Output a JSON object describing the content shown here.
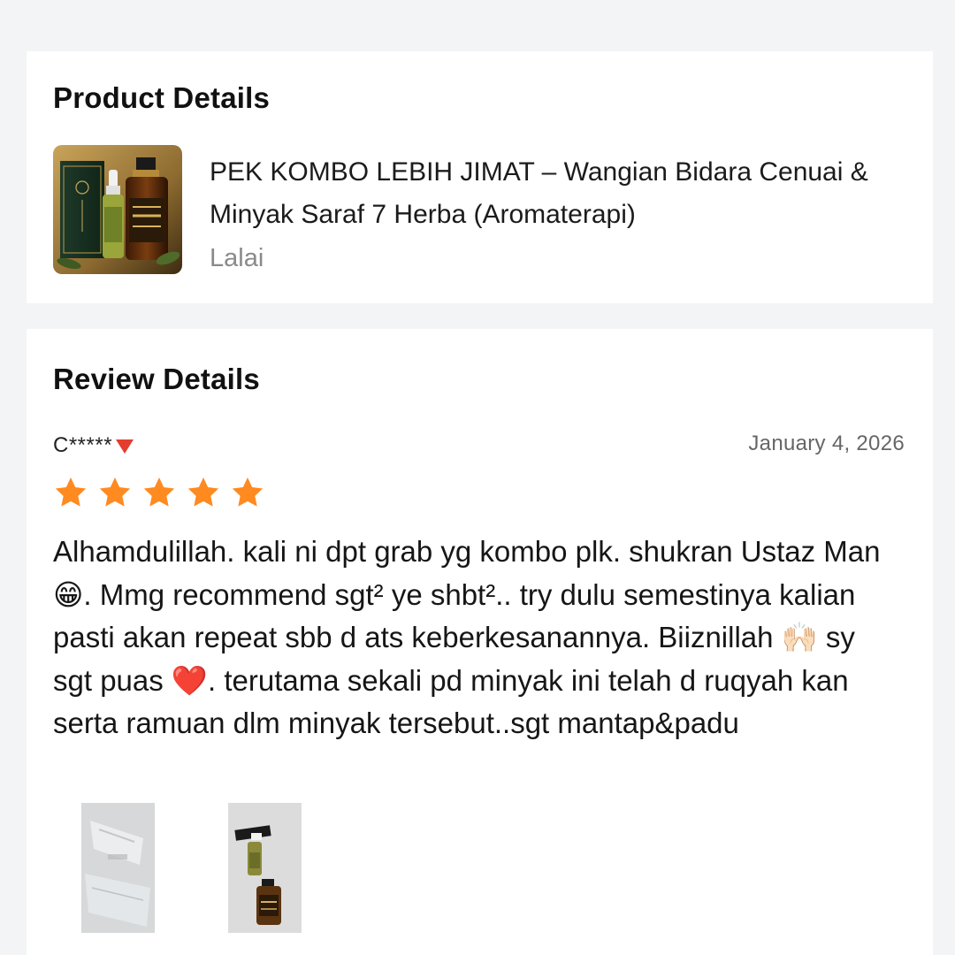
{
  "product_section": {
    "heading": "Product Details",
    "product": {
      "name": "PEK KOMBO LEBIH JIMAT – Wangian Bidara Cenuai & Minyak Saraf 7 Herba (Aromaterapi)",
      "variant": "Lalai",
      "thumbnail_icon": "product-bottles-image"
    }
  },
  "review_section": {
    "heading": "Review Details",
    "review": {
      "reviewer": "C*****",
      "reviewer_badge_icon": "red-triangle-down-icon",
      "date": "January 4, 2026",
      "rating": 5,
      "rating_max": 5,
      "star_color": "#ff8a1f",
      "text": "Alhamdulillah. kali ni dpt grab yg kombo plk. shukran Ustaz Man 😁. Mmg recommend sgt² ye shbt².. try dulu semestinya kalian pasti akan repeat sbb d ats keberkesanannya. Biiznillah 🙌🏻 sy sgt puas ❤️. terutama sekali pd minyak ini telah d ruqyah kan serta ramuan dlm minyak tersebut..sgt mantap&padu",
      "photos": [
        {
          "icon": "packaging-photo"
        },
        {
          "icon": "bottles-photo"
        }
      ]
    }
  },
  "colors": {
    "accent_star": "#ff8a1f",
    "page_background": "#f3f4f6",
    "card_background": "#ffffff",
    "muted_text": "#8a8a8a"
  }
}
